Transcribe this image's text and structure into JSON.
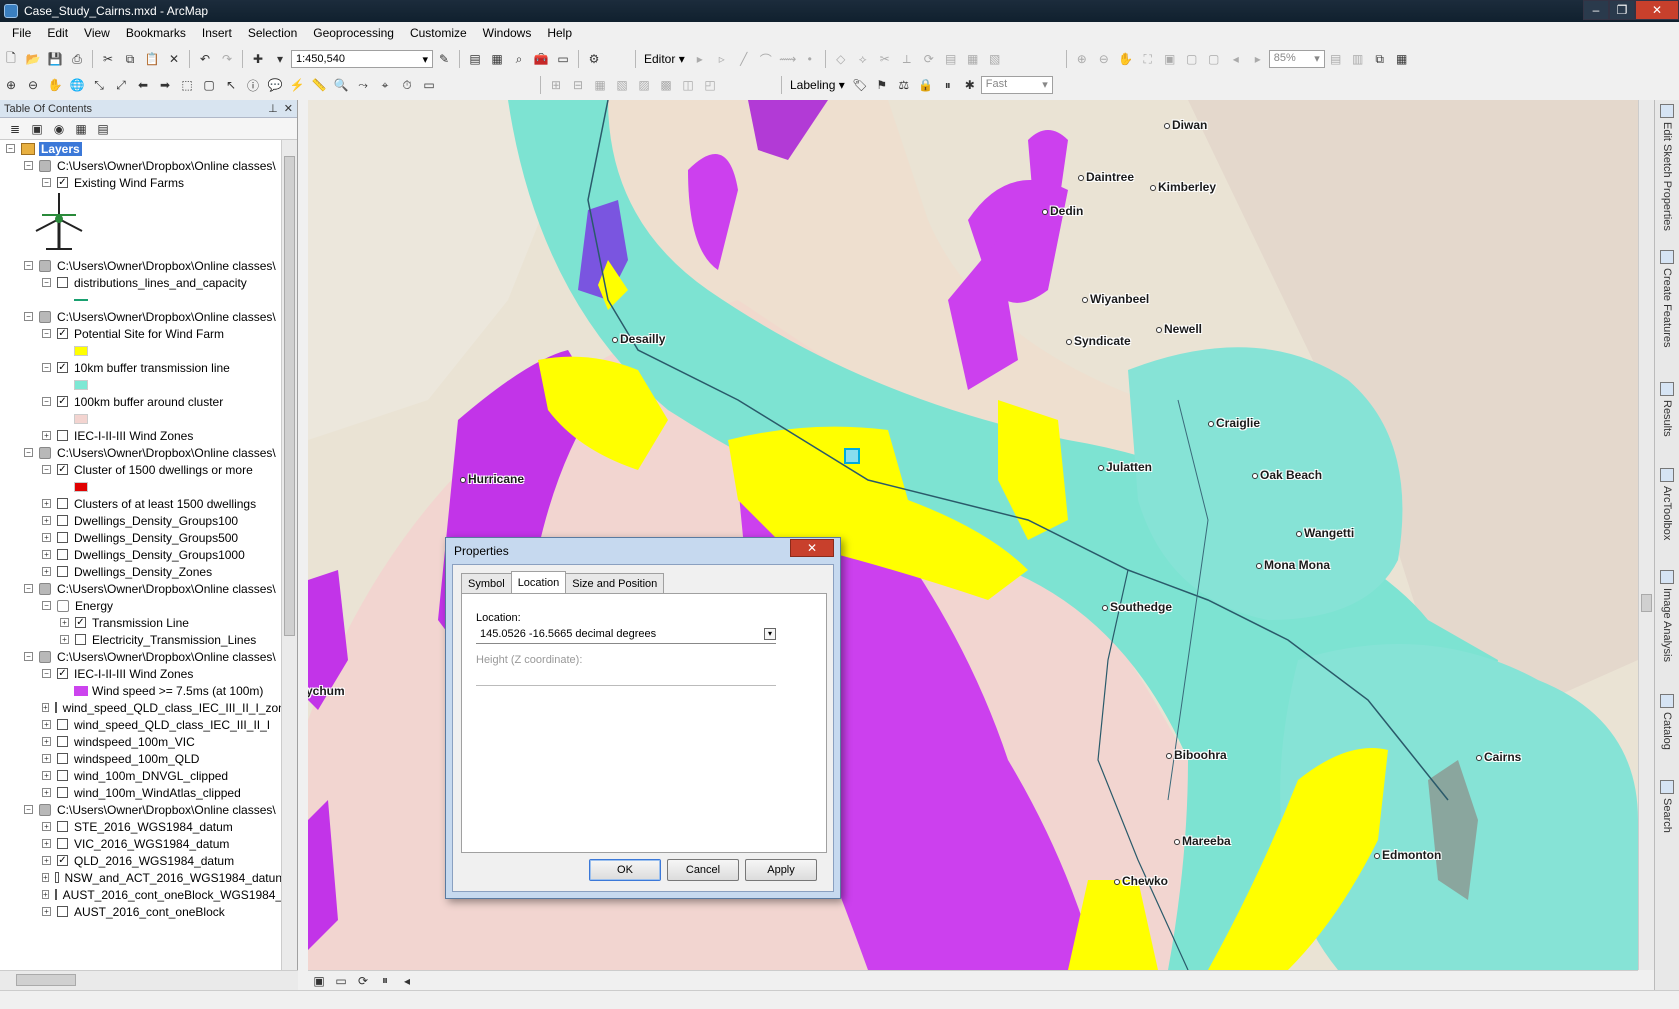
{
  "window": {
    "title": "Case_Study_Cairns.mxd - ArcMap"
  },
  "menu": [
    "File",
    "Edit",
    "View",
    "Bookmarks",
    "Insert",
    "Selection",
    "Geoprocessing",
    "Customize",
    "Windows",
    "Help"
  ],
  "toolbar": {
    "scale": "1:450,540",
    "editor_label": "Editor",
    "labeling_label": "Labeling",
    "zoom_percent": "85%",
    "quality": "Fast"
  },
  "toc": {
    "title": "Table Of Contents",
    "root": "Layers",
    "rows": [
      {
        "kind": "group",
        "label": "C:\\Users\\Owner\\Dropbox\\Online classes\\"
      },
      {
        "kind": "layer",
        "checked": true,
        "label": "Existing Wind Farms"
      },
      {
        "kind": "group",
        "label": "C:\\Users\\Owner\\Dropbox\\Online classes\\"
      },
      {
        "kind": "layer",
        "checked": false,
        "label": "distributions_lines_and_capacity"
      },
      {
        "kind": "group",
        "label": "C:\\Users\\Owner\\Dropbox\\Online classes\\"
      },
      {
        "kind": "layer",
        "checked": true,
        "label": "Potential Site for Wind Farm"
      },
      {
        "kind": "layer",
        "checked": true,
        "label": "10km buffer transmission line"
      },
      {
        "kind": "layer",
        "checked": true,
        "label": "100km buffer around cluster"
      },
      {
        "kind": "layer",
        "checked": false,
        "label": "IEC-I-II-III Wind Zones"
      },
      {
        "kind": "group",
        "label": "C:\\Users\\Owner\\Dropbox\\Online classes\\"
      },
      {
        "kind": "layer",
        "checked": true,
        "label": "Cluster of 1500 dwellings or more"
      },
      {
        "kind": "layer",
        "checked": false,
        "label": "Clusters of at least 1500 dwellings"
      },
      {
        "kind": "layer",
        "checked": false,
        "label": "Dwellings_Density_Groups100"
      },
      {
        "kind": "layer",
        "checked": false,
        "label": "Dwellings_Density_Groups500"
      },
      {
        "kind": "layer",
        "checked": false,
        "label": "Dwellings_Density_Groups1000"
      },
      {
        "kind": "layer",
        "checked": false,
        "label": "Dwellings_Density_Zones"
      },
      {
        "kind": "group",
        "label": "C:\\Users\\Owner\\Dropbox\\Online classes\\"
      },
      {
        "kind": "sub",
        "label": "Energy"
      },
      {
        "kind": "layer",
        "checked": true,
        "label": "Transmission Line"
      },
      {
        "kind": "layer",
        "checked": false,
        "label": "Electricity_Transmission_Lines"
      },
      {
        "kind": "group",
        "label": "C:\\Users\\Owner\\Dropbox\\Online classes\\"
      },
      {
        "kind": "layer",
        "checked": true,
        "label": "IEC-I-II-III Wind Zones"
      },
      {
        "kind": "legend",
        "label": "Wind speed >= 7.5ms (at 100m)"
      },
      {
        "kind": "layer",
        "checked": false,
        "label": "wind_speed_QLD_class_IEC_III_II_I_zon"
      },
      {
        "kind": "layer",
        "checked": false,
        "label": "wind_speed_QLD_class_IEC_III_II_I"
      },
      {
        "kind": "layer",
        "checked": false,
        "label": "windspeed_100m_VIC"
      },
      {
        "kind": "layer",
        "checked": false,
        "label": "windspeed_100m_QLD"
      },
      {
        "kind": "layer",
        "checked": false,
        "label": "wind_100m_DNVGL_clipped"
      },
      {
        "kind": "layer",
        "checked": false,
        "label": "wind_100m_WindAtlas_clipped"
      },
      {
        "kind": "group",
        "label": "C:\\Users\\Owner\\Dropbox\\Online classes\\"
      },
      {
        "kind": "layer",
        "checked": false,
        "label": "STE_2016_WGS1984_datum"
      },
      {
        "kind": "layer",
        "checked": false,
        "label": "VIC_2016_WGS1984_datum"
      },
      {
        "kind": "layer",
        "checked": true,
        "label": "QLD_2016_WGS1984_datum"
      },
      {
        "kind": "layer",
        "checked": false,
        "label": "NSW_and_ACT_2016_WGS1984_datun"
      },
      {
        "kind": "layer",
        "checked": false,
        "label": "AUST_2016_cont_oneBlock_WGS1984_"
      },
      {
        "kind": "layer",
        "checked": false,
        "label": "AUST_2016_cont_oneBlock"
      }
    ]
  },
  "map": {
    "places": [
      "Diwan",
      "Daintree",
      "Kimberley",
      "Dedin",
      "Wiyanbeel",
      "Syndicate",
      "Newell",
      "Desailly",
      "Craiglie",
      "Julatten",
      "Oak Beach",
      "Wangetti",
      "Mona Mona",
      "Southedge",
      "Hurricane",
      "Mychum",
      "Biboohra",
      "Mareeba",
      "Cairns",
      "Edmonton",
      "Chewko"
    ],
    "colors": {
      "wind_zone": "#cc44ee",
      "buffer_line": "#7de8d4",
      "buffer_cluster": "#f3d4d0",
      "site": "#ffff00",
      "terrain": "#e9dfcf"
    }
  },
  "dialog": {
    "title": "Properties",
    "close_label": "✕",
    "tabs": [
      "Symbol",
      "Location",
      "Size and Position"
    ],
    "active_tab": "Location",
    "location_label": "Location:",
    "location_value": "145.0526  -16.5665 decimal degrees",
    "height_label": "Height (Z coordinate):",
    "ok": "OK",
    "cancel": "Cancel",
    "apply": "Apply"
  },
  "side_tabs": [
    "Edit Sketch Properties",
    "Create Features",
    "Results",
    "ArcToolbox",
    "Image Analysis",
    "Catalog",
    "Search"
  ]
}
